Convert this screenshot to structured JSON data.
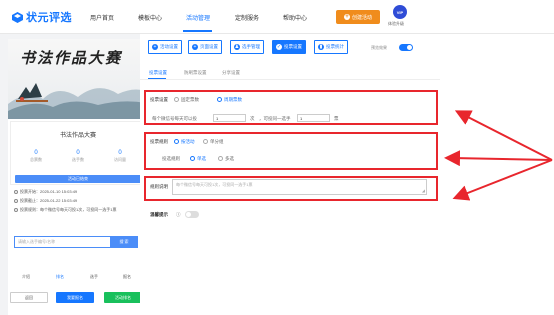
{
  "brand": {
    "name": "状元评选"
  },
  "nav": [
    {
      "label": "用户首页"
    },
    {
      "label": "模板中心"
    },
    {
      "label": "活动管理"
    },
    {
      "label": "定制服务"
    },
    {
      "label": "帮助中心"
    }
  ],
  "header": {
    "create_btn": "创建活动",
    "avatar_text": "VIP",
    "avatar_label": "体验升级"
  },
  "toolbar": [
    {
      "label": "活动设置",
      "icon": "plus"
    },
    {
      "label": "页面设置",
      "icon": "plus"
    },
    {
      "label": "选手管理",
      "icon": "users"
    },
    {
      "label": "投票设置",
      "icon": "vote"
    },
    {
      "label": "投票统计",
      "icon": "bar-chart"
    }
  ],
  "preview": {
    "label": "预览效果",
    "enabled": true
  },
  "subtabs": [
    {
      "label": "投票设置"
    },
    {
      "label": "防刷票设置"
    },
    {
      "label": "分享设置"
    }
  ],
  "form": {
    "vote_setting_label": "投票设置",
    "fixed_vote": "固定票数",
    "cycle_vote": "周期票数",
    "per_day_prefix": "每个微信号每天可以投",
    "per_day_value": "1",
    "per_day_unit": "次",
    "per_player_prefix": "，可投同一选手",
    "per_player_value": "1",
    "per_player_unit": "票",
    "rule_label": "投票规则",
    "by_activity": "按活动",
    "by_category": "单分组",
    "grouping_label": "投选规则",
    "single": "单选",
    "multi": "多选",
    "desc_label": "规则说明",
    "desc_placeholder": "每个微信号每天可投1次，可投同一选手1票",
    "tip_label": "温馨提示",
    "tip_enabled": false
  },
  "left": {
    "banner_title": "书法作品大赛",
    "card_title": "书法作品大赛",
    "stats": [
      {
        "value": "0",
        "label": "总票数"
      },
      {
        "value": "0",
        "label": "选手数"
      },
      {
        "value": "0",
        "label": "访问量"
      }
    ],
    "rank_button": "活动已结束",
    "info": [
      "投票开始：2025-01-10 15:03:49",
      "投票截止：2025-01-22 15:03:49",
      "投票规则：每个微信号每天可投1次，可投同一选手1票"
    ],
    "search_placeholder": "请输入选手编号/名称",
    "search_button": "搜 索",
    "tabs": [
      "介绍",
      "排名",
      "选手",
      "报名"
    ],
    "buttons": {
      "back": "返回",
      "join": "我要报名",
      "rank": "活动排名"
    }
  },
  "colors": {
    "primary": "#1677ff",
    "orange": "#f08c1c",
    "red": "#e8262d",
    "green": "#19c05c"
  }
}
